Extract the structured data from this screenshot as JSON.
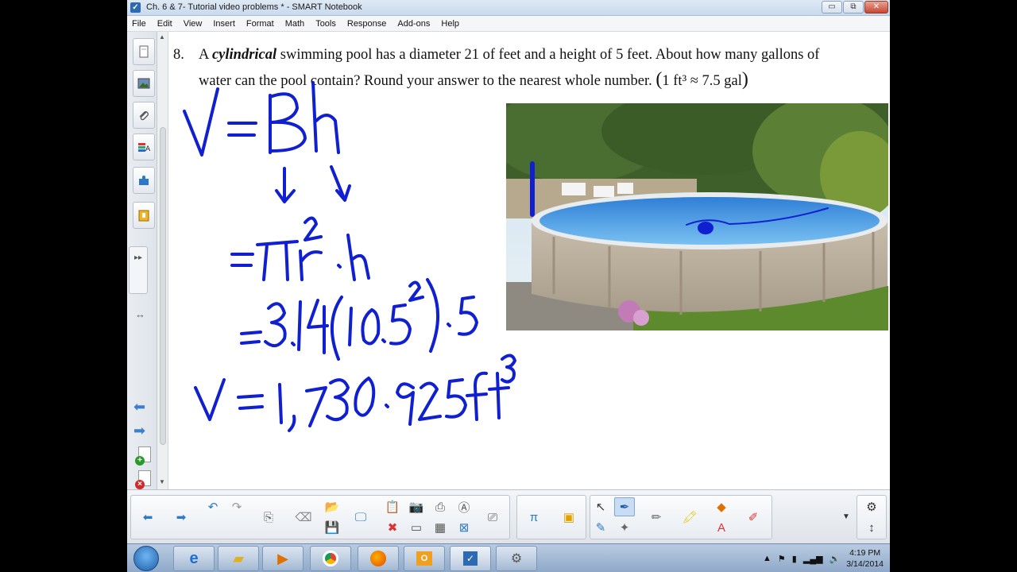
{
  "window": {
    "title": "Ch. 6 & 7- Tutorial video problems * - SMART Notebook",
    "minimize": "▭",
    "maximize": "⧉",
    "close": "✕"
  },
  "menu": [
    "File",
    "Edit",
    "View",
    "Insert",
    "Format",
    "Math",
    "Tools",
    "Response",
    "Add-ons",
    "Help"
  ],
  "question": {
    "number": "8.",
    "line1_a": "A ",
    "line1_emph": "cylindrical",
    "line1_b": " swimming pool has a diameter 21 of feet and a height of 5 feet. About how many gallons of",
    "line2": "water can the pool contain? Round your answer to the nearest whole number.",
    "conversion": "1 ft³ ≈ 7.5 gal"
  },
  "handwriting": {
    "line1": "V = Bh",
    "line2": "= πr²·h",
    "line3": "= 3.14(10.5²)·5",
    "line4": "V = 1,730.925 ft³"
  },
  "sidebar": {
    "buttons": [
      "page-sorter",
      "gallery",
      "attachments",
      "properties",
      "add-ons",
      "response"
    ],
    "handle": "▸▸"
  },
  "taskbar": {
    "time": "4:19 PM",
    "date": "3/14/2014"
  },
  "colors": {
    "ink": "#1020d0",
    "accent": "#3d7fc9"
  }
}
